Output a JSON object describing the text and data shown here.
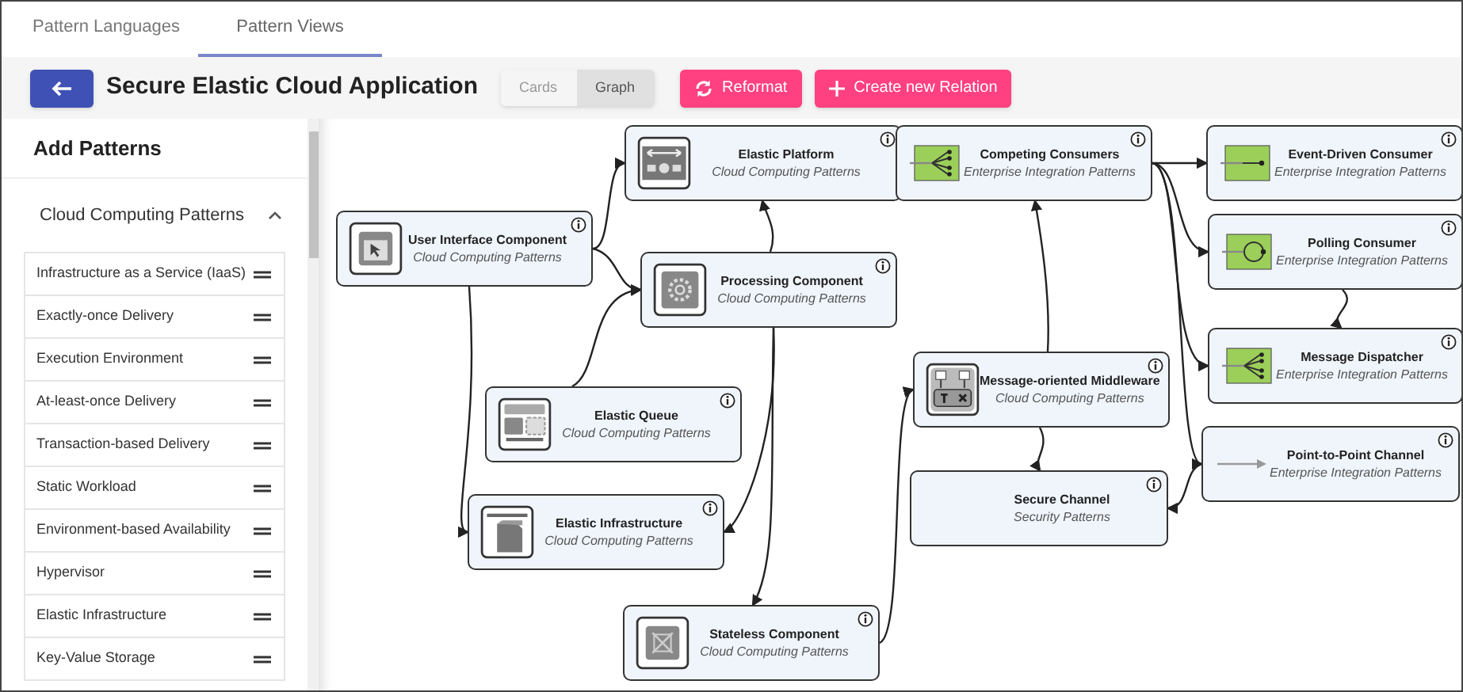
{
  "tabs": [
    {
      "label": "Pattern Languages",
      "selected": false
    },
    {
      "label": "Pattern Views",
      "selected": true
    }
  ],
  "toolbar": {
    "title": "Secure Elastic Cloud Application",
    "view_toggle": [
      {
        "label": "Cards",
        "selected": false
      },
      {
        "label": "Graph",
        "selected": true
      }
    ],
    "buttons": [
      {
        "label": "Reformat",
        "kind": "reformat"
      },
      {
        "label": "Create new Relation",
        "kind": "add"
      }
    ]
  },
  "sidebar": {
    "title": "Add Patterns",
    "section": {
      "label": "Cloud Computing Patterns",
      "expanded": true
    },
    "items": [
      "Infrastructure as a Service (IaaS)",
      "Exactly-once Delivery",
      "Execution Environment",
      "At-least-once Delivery",
      "Transaction-based Delivery",
      "Static Workload",
      "Environment-based Availability",
      "Hypervisor",
      "Elastic Infrastructure",
      "Key-Value Storage"
    ]
  },
  "graph": {
    "nodes": [
      {
        "title": "Elastic Platform",
        "category": "Cloud Computing Patterns"
      },
      {
        "title": "User Interface Component",
        "category": "Cloud Computing Patterns"
      },
      {
        "title": "Processing Component",
        "category": "Cloud Computing Patterns"
      },
      {
        "title": "Elastic Queue",
        "category": "Cloud Computing Patterns"
      },
      {
        "title": "Elastic Infrastructure",
        "category": "Cloud Computing Patterns"
      },
      {
        "title": "Stateless Component",
        "category": "Cloud Computing Patterns"
      },
      {
        "title": "Competing Consumers",
        "category": "Enterprise Integration Patterns"
      },
      {
        "title": "Event-Driven Consumer",
        "category": "Enterprise Integration Patterns"
      },
      {
        "title": "Polling Consumer",
        "category": "Enterprise Integration Patterns"
      },
      {
        "title": "Message Dispatcher",
        "category": "Enterprise Integration Patterns"
      },
      {
        "title": "Message-oriented Middleware",
        "category": "Cloud Computing Patterns"
      },
      {
        "title": "Point-to-Point Channel",
        "category": "Enterprise Integration Patterns"
      },
      {
        "title": "Secure Channel",
        "category": "Security Patterns"
      }
    ]
  }
}
